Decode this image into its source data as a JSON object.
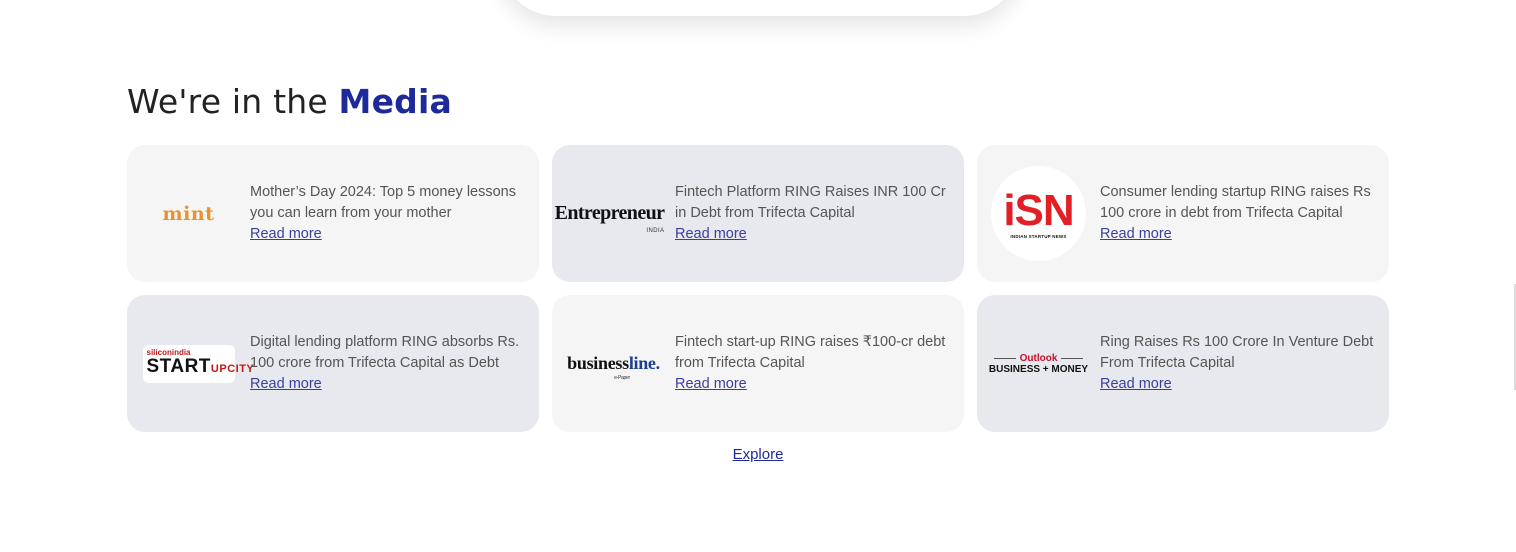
{
  "section": {
    "heading_prefix": "We're in the ",
    "heading_accent": "Media"
  },
  "colors": {
    "accent": "#1f2a9a",
    "card_light": "#f5f5f6",
    "card_dark": "#e8e9ee"
  },
  "cards": [
    {
      "logo": "mint",
      "logo_text": "mint",
      "headline": "Mother’s Day 2024: Top 5 money lessons you can learn from your mother",
      "link": "Read more"
    },
    {
      "logo": "entrepreneur",
      "logo_text": "Entrepreneur",
      "logo_sub": "INDIA",
      "headline": "Fintech Platform RING Raises INR 100 Cr in Debt from Trifecta Capital",
      "link": "Read more"
    },
    {
      "logo": "isn",
      "logo_text": "iSN",
      "logo_sub": "INDIAN STARTUP NEWS",
      "headline": "Consumer lending startup RING raises Rs 100 crore in debt from Trifecta Capital",
      "link": "Read more"
    },
    {
      "logo": "startup-city",
      "logo_top": "siliconindia",
      "logo_main": "START",
      "logo_up": "UP",
      "logo_city": "CITY",
      "headline": "Digital lending platform RING absorbs Rs. 100 crore from Trifecta Capital as Debt",
      "link": "Read more"
    },
    {
      "logo": "businessline",
      "logo_main": "business",
      "logo_line": "line.",
      "logo_sub": "e-Paper",
      "headline": "Fintech start-up RING raises ₹100-cr debt from Trifecta Capital",
      "link": "Read more"
    },
    {
      "logo": "outlook-business-money",
      "logo_top": "Outlook",
      "logo_bottom": "BUSINESS + MONEY",
      "headline": "Ring Raises Rs 100 Crore In Venture Debt From Trifecta Capital",
      "link": "Read more"
    }
  ],
  "explore_label": "Explore"
}
